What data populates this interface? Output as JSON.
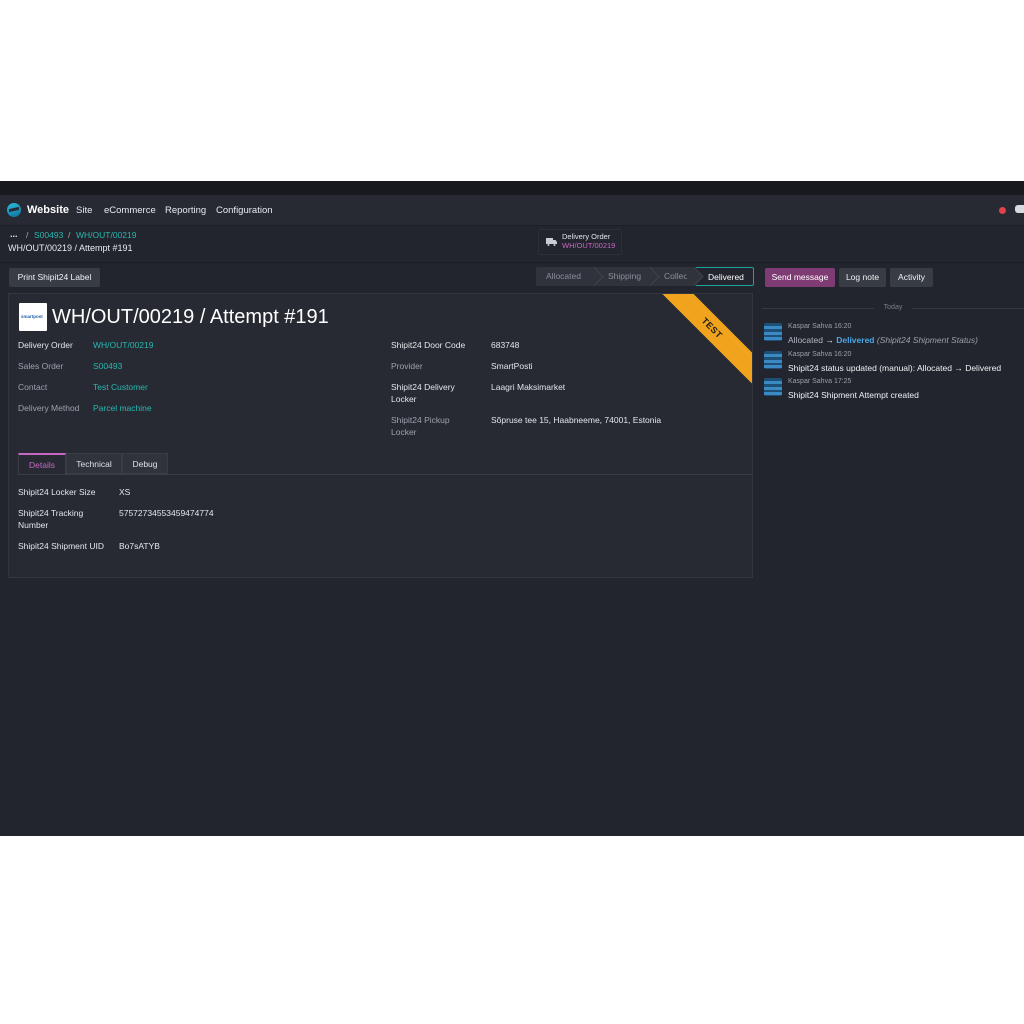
{
  "navbar": {
    "app_name": "Website",
    "menus": [
      "Site",
      "eCommerce",
      "Reporting",
      "Configuration"
    ]
  },
  "breadcrumb": {
    "ellipsis": "...",
    "sep": "/",
    "items": [
      "S00493",
      "WH/OUT/00219"
    ],
    "current": "WH/OUT/00219 / Attempt #191"
  },
  "smart_button": {
    "title": "Delivery Order",
    "value": "WH/OUT/00219"
  },
  "actions": {
    "print_label": "Print Shipit24 Label"
  },
  "statusbar": {
    "stages": [
      "Allocated",
      "Shipping",
      "Collect",
      "Delivered"
    ],
    "active": "Delivered"
  },
  "chatter_buttons": {
    "send": "Send message",
    "log": "Log note",
    "activity": "Activity"
  },
  "record": {
    "logo_text": "smartpost",
    "title": "WH/OUT/00219 / Attempt #191",
    "ribbon": "TEST",
    "left_fields": [
      {
        "label": "Delivery Order",
        "value": "WH/OUT/00219"
      },
      {
        "label": "Sales Order",
        "value": "S00493"
      },
      {
        "label": "Contact",
        "value": "Test Customer"
      },
      {
        "label": "Delivery Method",
        "value": "Parcel machine"
      }
    ],
    "right_fields": [
      {
        "label": "Shipit24 Door Code",
        "value": "683748"
      },
      {
        "label": "Provider",
        "value": "SmartPosti"
      },
      {
        "label": "Shipit24 Delivery Locker",
        "value": "Laagri Maksimarket"
      },
      {
        "label": "Shipit24 Pickup Locker",
        "value": "Sõpruse tee 15, Haabneeme, 74001, Estonia"
      }
    ],
    "tabs": [
      "Details",
      "Technical",
      "Debug"
    ],
    "details": [
      {
        "label": "Shipit24 Locker Size",
        "value": "XS"
      },
      {
        "label": "Shipit24 Tracking Number",
        "value": "57572734553459474774"
      },
      {
        "label": "Shipit24 Shipment UID",
        "value": "Bo7sATYB"
      }
    ]
  },
  "chatter": {
    "today": "Today",
    "messages": [
      {
        "author": "Kaspar Sahva",
        "time": "16:20",
        "old": "Allocated",
        "arrow": "→",
        "new": "Delivered",
        "field": "(Shipit24 Shipment Status)"
      },
      {
        "author": "Kaspar Sahva",
        "time": "16:20",
        "body": "Shipit24 status updated (manual): Allocated → Delivered"
      },
      {
        "author": "Kaspar Sahva",
        "time": "17:25",
        "body": "Shipit24 Shipment Attempt created"
      }
    ]
  },
  "colors": {
    "accent": "#27b8b0",
    "primary": "#7f3b74",
    "ribbon": "#f0a31c",
    "tab_active": "#c767c4"
  }
}
